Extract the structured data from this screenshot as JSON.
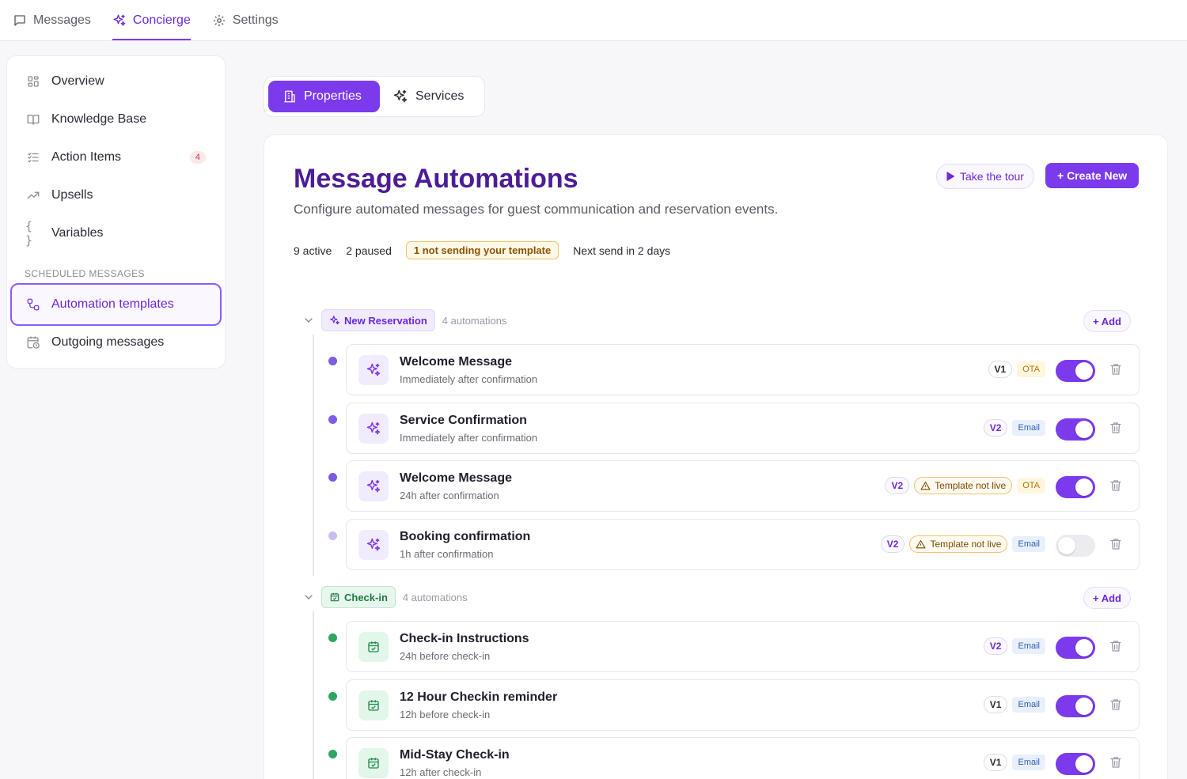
{
  "topnav": {
    "tabs": [
      {
        "label": "Messages",
        "icon": "message-square-icon",
        "active": false
      },
      {
        "label": "Concierge",
        "icon": "sparkles-icon",
        "active": true
      },
      {
        "label": "Settings",
        "icon": "gear-icon",
        "active": false
      }
    ]
  },
  "sidebar": {
    "items": [
      {
        "label": "Overview",
        "icon": "grid-icon"
      },
      {
        "label": "Knowledge Base",
        "icon": "book-icon"
      },
      {
        "label": "Action Items",
        "icon": "checklist-icon",
        "badge": "4"
      },
      {
        "label": "Upsells",
        "icon": "trending-up-icon"
      },
      {
        "label": "Variables",
        "icon": "braces-icon"
      }
    ],
    "section_label": "SCHEDULED MESSAGES",
    "scheduled": [
      {
        "label": "Automation templates",
        "icon": "workflow-icon",
        "active": true
      },
      {
        "label": "Outgoing messages",
        "icon": "calendar-clock-icon",
        "active": false
      }
    ]
  },
  "segment": {
    "properties": "Properties",
    "services": "Services"
  },
  "main": {
    "title": "Message Automations",
    "subtitle": "Configure automated messages for guest communication and reservation events.",
    "stats": {
      "active": "9 active",
      "paused": "2 paused",
      "warning": "1 not sending your template",
      "next": "Next send in 2 days"
    },
    "tour_button": "Take the tour",
    "create_button": "+ Create New",
    "add_label": "+ Add"
  },
  "groups": [
    {
      "name": "New Reservation",
      "count": "4 automations",
      "color": "#7c3aed",
      "rows": [
        {
          "title": "Welcome Message",
          "sub": "Immediately after confirmation",
          "version": "V1",
          "tnl": "",
          "channel": "OTA",
          "enabled": true
        },
        {
          "title": "Service Confirmation",
          "sub": "Immediately after confirmation",
          "version": "V2",
          "tnl": "",
          "channel": "Email",
          "enabled": true
        },
        {
          "title": "Welcome Message",
          "sub": "24h after confirmation",
          "version": "V2",
          "tnl": "Template not live",
          "channel": "OTA",
          "enabled": true
        },
        {
          "title": "Booking confirmation",
          "sub": "1h after confirmation",
          "version": "V2",
          "tnl": "Template not live",
          "channel": "Email",
          "enabled": false
        }
      ]
    },
    {
      "name": "Check-in",
      "count": "4 automations",
      "color": "#22a05a",
      "rows": [
        {
          "title": "Check-in Instructions",
          "sub": "24h before check-in",
          "version": "V2",
          "tnl": "",
          "channel": "Email",
          "enabled": true
        },
        {
          "title": "12 Hour Checkin reminder",
          "sub": "12h before check-in",
          "version": "V1",
          "tnl": "",
          "channel": "Email",
          "enabled": true
        },
        {
          "title": "Mid-Stay Check-in",
          "sub": "12h after check-in",
          "version": "V1",
          "tnl": "",
          "channel": "Email",
          "enabled": true
        }
      ]
    }
  ]
}
